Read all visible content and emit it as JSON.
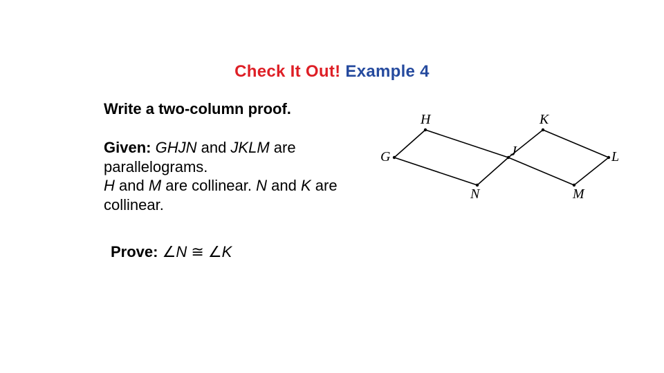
{
  "heading": {
    "part1": "Check It Out!",
    "part2": "Example 4"
  },
  "instruction": "Write a two-column proof.",
  "given": {
    "label": "Given:",
    "ghjn": "GHJN",
    "and1": " and ",
    "jklm": "JKLM",
    "are_para": " are parallelograms.",
    "h": "H",
    "and2": " and ",
    "m": "M",
    "coll1": " are collinear. ",
    "n": "N",
    "and3": " and ",
    "k": "K",
    "coll2": " are collinear."
  },
  "prove": {
    "label": "Prove:",
    "angle_sym1": "∠",
    "n": "N",
    "cong": " ≅ ",
    "angle_sym2": "∠",
    "k": "K"
  },
  "figure": {
    "labels": {
      "G": "G",
      "H": "H",
      "J": "J",
      "N": "N",
      "K": "K",
      "L": "L",
      "M": "M"
    }
  }
}
